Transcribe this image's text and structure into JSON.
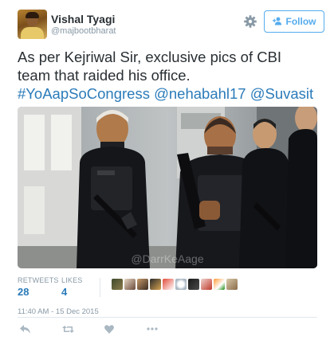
{
  "user": {
    "display_name": "Vishal Tyagi",
    "screen_name": "@majbootbharat"
  },
  "header": {
    "gear_icon": "gear-icon",
    "follow_label": "Follow",
    "follow_icon": "add-user-icon",
    "accent_color": "#55acee"
  },
  "tweet": {
    "text_line1": "As per Kejriwal Sir, exclusive pics of CBI",
    "text_line2": "team that raided his office.",
    "hashtag": "#YoAapSoCongress",
    "mention1": "@nehabahl17",
    "mention2": "@Suvasit",
    "link_color": "#2b7bb9"
  },
  "photo": {
    "watermark": "@DarrKeAage"
  },
  "stats": {
    "retweets_label": "RETWEETS",
    "retweets_count": "28",
    "likes_label": "LIKES",
    "likes_count": "4"
  },
  "timestamp": "11:40 AM - 15 Dec 2015",
  "actions": [
    "reply-icon",
    "retweet-icon",
    "like-icon",
    "more-icon"
  ]
}
